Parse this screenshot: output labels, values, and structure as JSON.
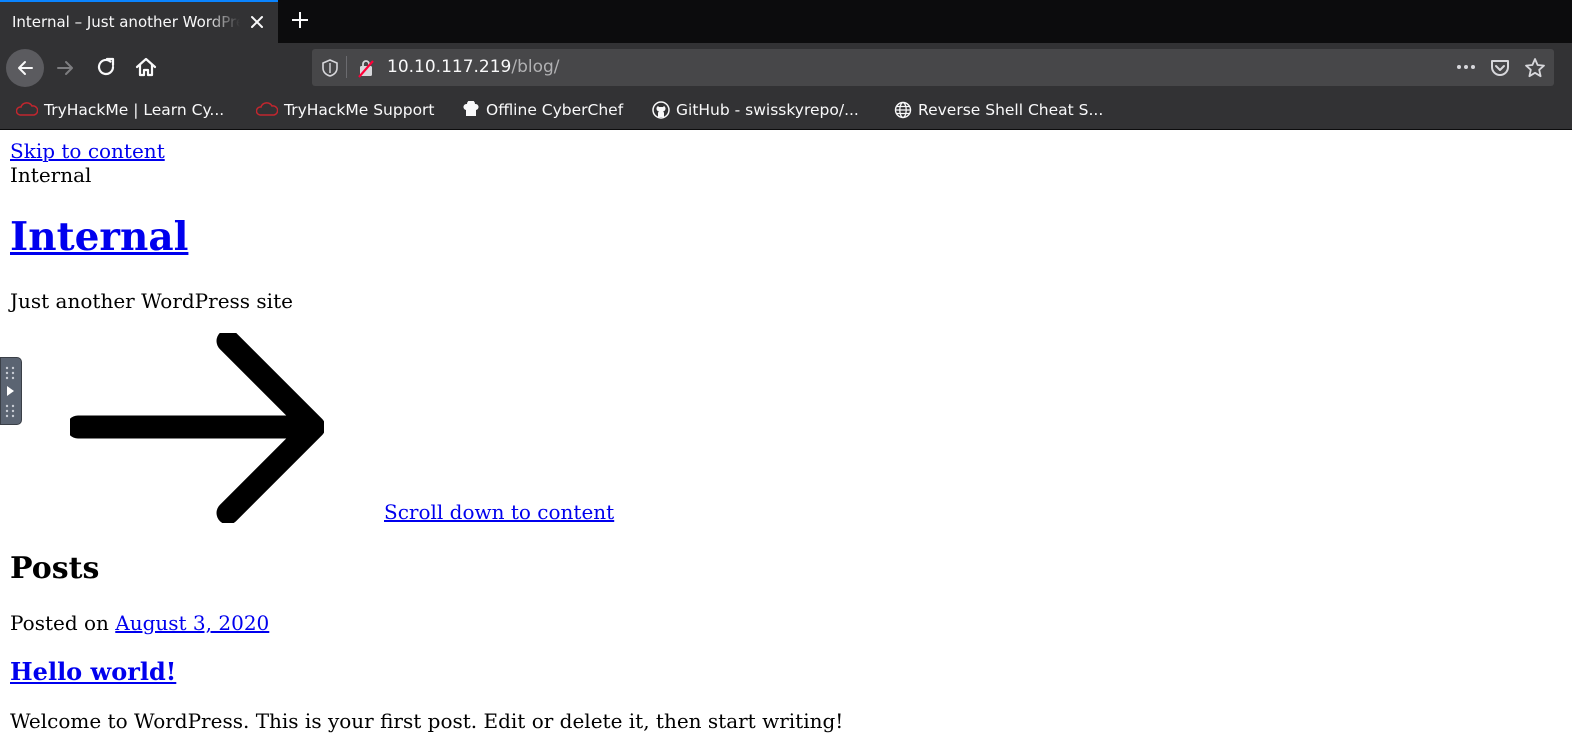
{
  "browser": {
    "tab": {
      "title": "Internal – Just another WordPress site"
    },
    "url": {
      "host": "10.10.117.219",
      "path": "/blog/"
    },
    "bookmarks": [
      {
        "label": "TryHackMe | Learn Cy...",
        "icon": "tryhackme-icon"
      },
      {
        "label": "TryHackMe Support",
        "icon": "tryhackme-icon"
      },
      {
        "label": "Offline CyberChef",
        "icon": "cyberchef-icon"
      },
      {
        "label": "GitHub - swisskyrepo/...",
        "icon": "github-icon"
      },
      {
        "label": "Reverse Shell Cheat S...",
        "icon": "globe-icon"
      }
    ],
    "colors": {
      "accent": "#0a84ff",
      "toolbar": "#323234",
      "tabstrip": "#0c0c0d"
    }
  },
  "page": {
    "skip_link": "Skip to content",
    "site_small": "Internal",
    "site_title": "Internal",
    "tagline": "Just another WordPress site",
    "scroll_link": "Scroll down to content",
    "posts_heading": "Posts",
    "posted_prefix": "Posted on",
    "post_date": "August 3, 2020",
    "post_title": "Hello world!",
    "post_excerpt": "Welcome to WordPress. This is your first post. Edit or delete it, then start writing!"
  }
}
